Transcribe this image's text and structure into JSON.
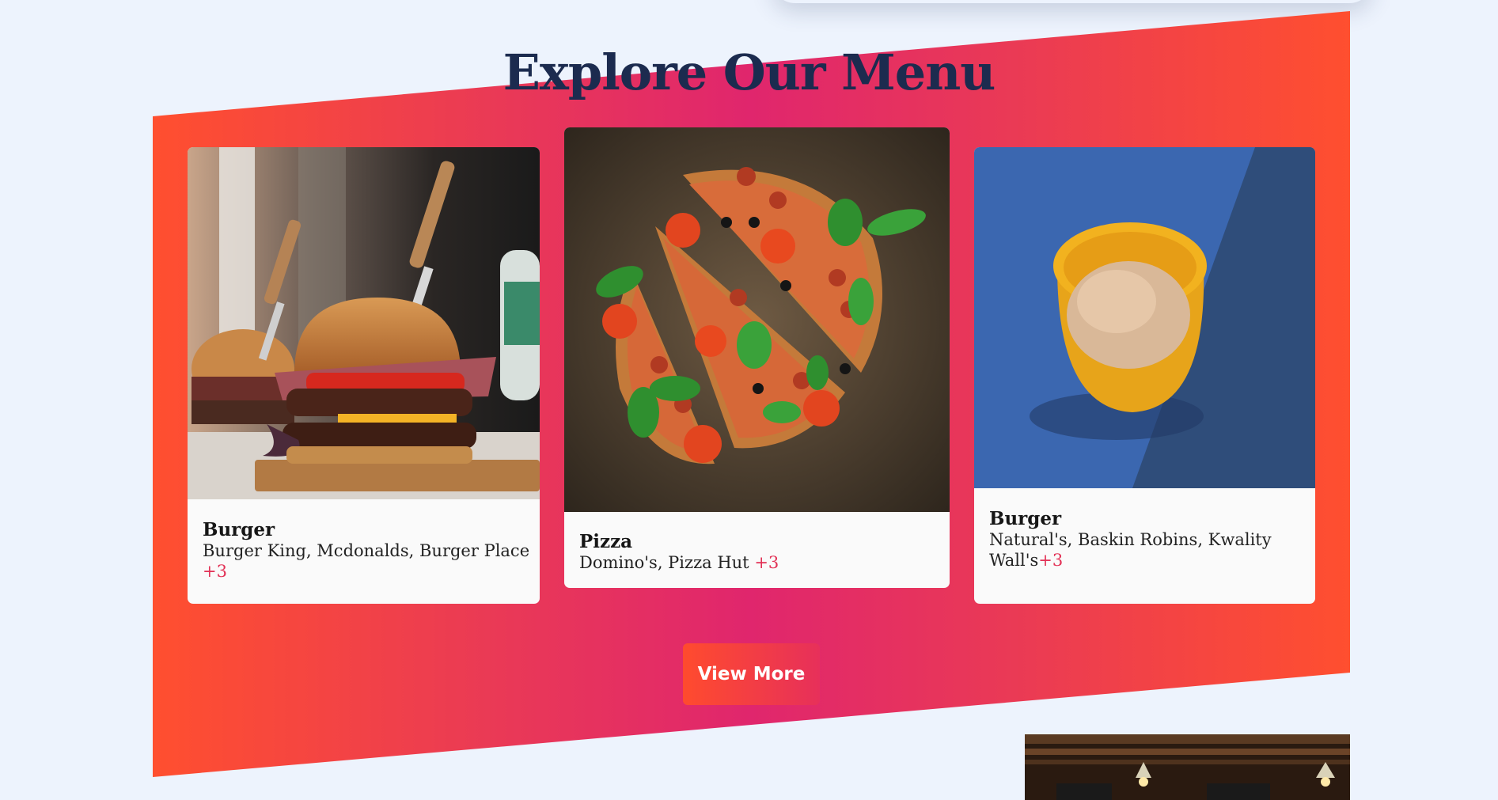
{
  "section": {
    "title": "Explore Our Menu",
    "view_more_label": "View More"
  },
  "cards": [
    {
      "name": "Burger",
      "places": "Burger King, Mcdonalds, Burger Place",
      "more": "+3",
      "image": "burger-photo"
    },
    {
      "name": "Pizza",
      "places": "Domino's, Pizza Hut",
      "more": "+3",
      "image": "pizza-photo"
    },
    {
      "name": "Burger",
      "places": "Natural's, Baskin Robins, Kwality Wall's",
      "more": "+3",
      "image": "ice-cream-photo"
    }
  ],
  "colors": {
    "background": "#edf3fd",
    "title": "#1c2b4f",
    "gradient_edge": "#ff4f2f",
    "gradient_center": "#e0266d",
    "accent": "#e23256"
  }
}
